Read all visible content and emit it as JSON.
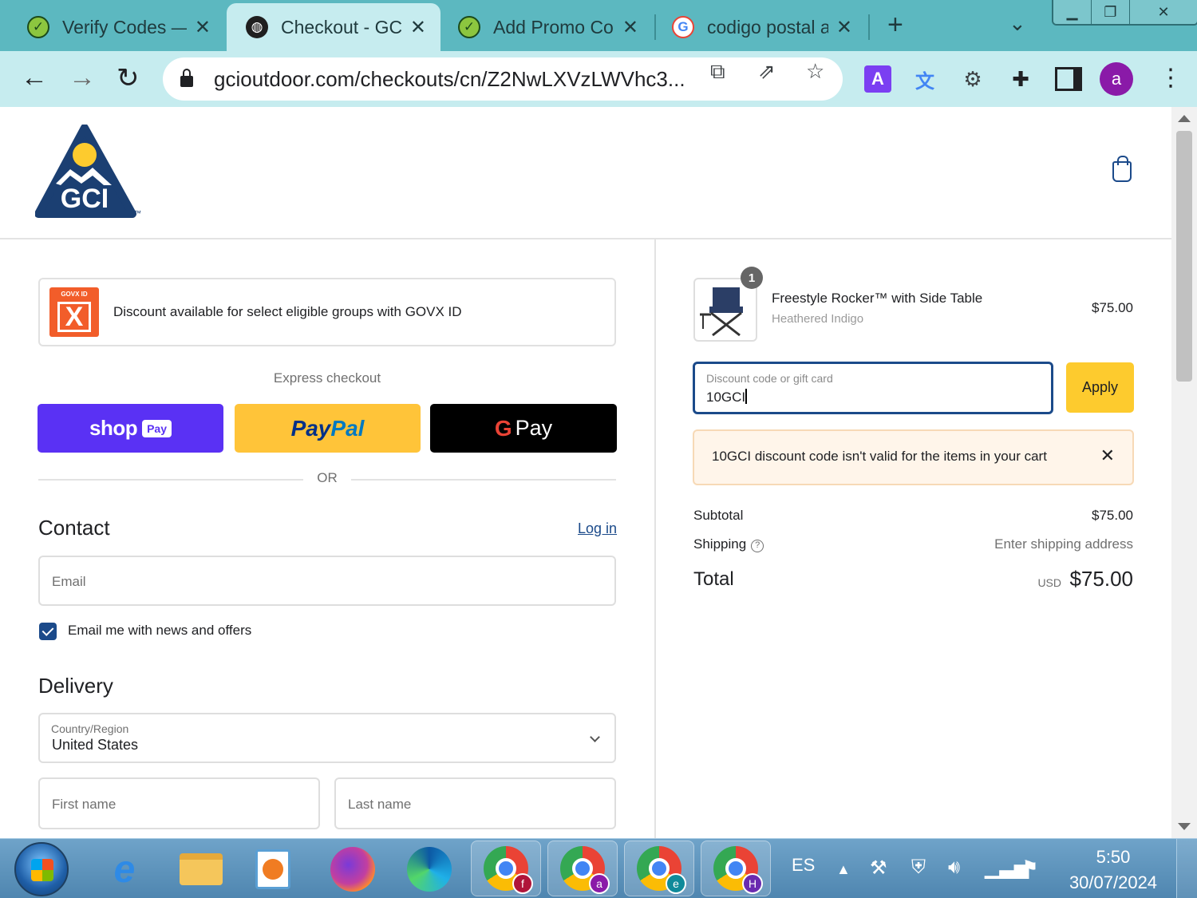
{
  "browser": {
    "tabs": [
      {
        "title": "Verify Codes —",
        "favicon": "green-check-icon"
      },
      {
        "title": "Checkout - GCI",
        "favicon": "globe-icon",
        "active": true
      },
      {
        "title": "Add Promo Co",
        "favicon": "green-check-icon"
      },
      {
        "title": "codigo postal a",
        "favicon": "google-icon"
      }
    ],
    "url": "gcioutdoor.com/checkouts/cn/Z2NwLXVzLWVhc3...",
    "profile_initial": "a",
    "extension_a_label": "A"
  },
  "header": {
    "logo_text": "GCI",
    "logo_tm": "™"
  },
  "govx": {
    "logo_top": "GOVX ID",
    "logo_mark": "X",
    "text": "Discount available for select eligible groups with GOVX ID"
  },
  "express": {
    "label": "Express checkout",
    "shop_word": "shop",
    "shop_badge": "Pay",
    "paypal_1": "Pay",
    "paypal_2": "Pal",
    "gpay_g": "G",
    "gpay_word": "Pay",
    "or": "OR"
  },
  "contact": {
    "title": "Contact",
    "login": "Log in",
    "email_placeholder": "Email",
    "newsletter_label": "Email me with news and offers",
    "newsletter_checked": true
  },
  "delivery": {
    "title": "Delivery",
    "country_label": "Country/Region",
    "country_value": "United States",
    "first_name_placeholder": "First name",
    "last_name_placeholder": "Last name"
  },
  "order": {
    "quantity": "1",
    "product_name": "Freestyle Rocker™ with Side Table",
    "product_variant": "Heathered Indigo",
    "product_price": "$75.00",
    "discount_label": "Discount code or gift card",
    "discount_value": "10GCI",
    "apply_label": "Apply",
    "error_message": "10GCI discount code isn't valid for the items in your cart",
    "subtotal_label": "Subtotal",
    "subtotal_value": "$75.00",
    "shipping_label": "Shipping",
    "shipping_value": "Enter shipping address",
    "total_label": "Total",
    "total_currency": "USD",
    "total_value": "$75.00"
  },
  "taskbar": {
    "language": "ES",
    "time": "5:50",
    "date": "30/07/2024",
    "chrome_badges": [
      "f",
      "a",
      "e",
      "H"
    ]
  },
  "colors": {
    "brand_navy": "#1b4a8a",
    "brand_yellow": "#fdcb2e",
    "tab_strip": "#5cb8c0",
    "shop_pay": "#5a31f4",
    "paypal": "#ffc439"
  }
}
